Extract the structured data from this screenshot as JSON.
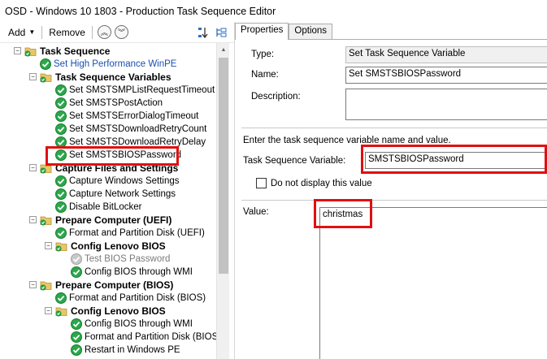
{
  "window": {
    "title": "OSD - Windows 10 1803 - Production Task Sequence Editor"
  },
  "toolbar": {
    "add_label": "Add",
    "remove_label": "Remove"
  },
  "tree": {
    "items": [
      {
        "label": "Task Sequence",
        "style": "bold",
        "icon": "folder-icon",
        "indent": 0
      },
      {
        "label": "Set High Performance WinPE",
        "style": "blue",
        "icon": "check-icon",
        "indent": 1
      },
      {
        "label": "Task Sequence Variables",
        "style": "bold",
        "icon": "folder-icon",
        "indent": 1
      },
      {
        "label": "Set SMSTSMPListRequestTimeout",
        "style": "normal",
        "icon": "check-icon",
        "indent": 2
      },
      {
        "label": "Set SMSTSPostAction",
        "style": "normal",
        "icon": "check-icon",
        "indent": 2
      },
      {
        "label": "Set SMSTSErrorDialogTimeout",
        "style": "normal",
        "icon": "check-icon",
        "indent": 2
      },
      {
        "label": "Set SMSTSDownloadRetryCount",
        "style": "normal",
        "icon": "check-icon",
        "indent": 2
      },
      {
        "label": "Set SMSTSDownloadRetryDelay",
        "style": "normal",
        "icon": "check-icon",
        "indent": 2
      },
      {
        "label": "Set SMSTSBIOSPassword",
        "style": "normal",
        "icon": "check-icon",
        "indent": 2
      },
      {
        "label": "Capture Files and Settings",
        "style": "bold",
        "icon": "folder-icon",
        "indent": 1
      },
      {
        "label": "Capture Windows Settings",
        "style": "normal",
        "icon": "check-icon",
        "indent": 2
      },
      {
        "label": "Capture Network Settings",
        "style": "normal",
        "icon": "check-icon",
        "indent": 2
      },
      {
        "label": "Disable BitLocker",
        "style": "normal",
        "icon": "check-icon",
        "indent": 2
      },
      {
        "label": "Prepare Computer (UEFI)",
        "style": "bold",
        "icon": "folder-icon",
        "indent": 1
      },
      {
        "label": "Format and Partition Disk (UEFI)",
        "style": "normal",
        "icon": "check-icon",
        "indent": 2
      },
      {
        "label": "Config Lenovo BIOS",
        "style": "bold",
        "icon": "folder-icon",
        "indent": 2
      },
      {
        "label": "Test BIOS Password",
        "style": "gray",
        "icon": "check-disabled-icon",
        "indent": 3
      },
      {
        "label": "Config BIOS through WMI",
        "style": "normal",
        "icon": "check-icon",
        "indent": 3
      },
      {
        "label": "Prepare Computer (BIOS)",
        "style": "bold",
        "icon": "folder-icon",
        "indent": 1
      },
      {
        "label": "Format and Partition Disk (BIOS)",
        "style": "normal",
        "icon": "check-icon",
        "indent": 2
      },
      {
        "label": "Config Lenovo BIOS",
        "style": "bold",
        "icon": "folder-icon",
        "indent": 2
      },
      {
        "label": "Config BIOS through WMI",
        "style": "normal",
        "icon": "check-icon",
        "indent": 3
      },
      {
        "label": "Format and Partition Disk (BIOS to",
        "style": "normal",
        "icon": "check-icon",
        "indent": 3
      },
      {
        "label": "Restart in Windows PE",
        "style": "normal",
        "icon": "check-icon",
        "indent": 3
      }
    ]
  },
  "tabs": [
    {
      "label": "Properties",
      "active": true
    },
    {
      "label": "Options",
      "active": false
    }
  ],
  "properties": {
    "type_label": "Type:",
    "type_value": "Set Task Sequence Variable",
    "name_label": "Name:",
    "name_value": "Set SMSTSBIOSPassword",
    "description_label": "Description:",
    "description_value": "",
    "instruction": "Enter the task sequence variable name and value.",
    "variable_label": "Task Sequence Variable:",
    "variable_value": "SMSTSBIOSPassword",
    "hide_value_label": "Do not display this value",
    "value_label": "Value:",
    "value_value": "christmas"
  },
  "colors": {
    "highlight": "#e01010",
    "check_green": "#2aa84a",
    "link_blue": "#1a4fb0"
  }
}
